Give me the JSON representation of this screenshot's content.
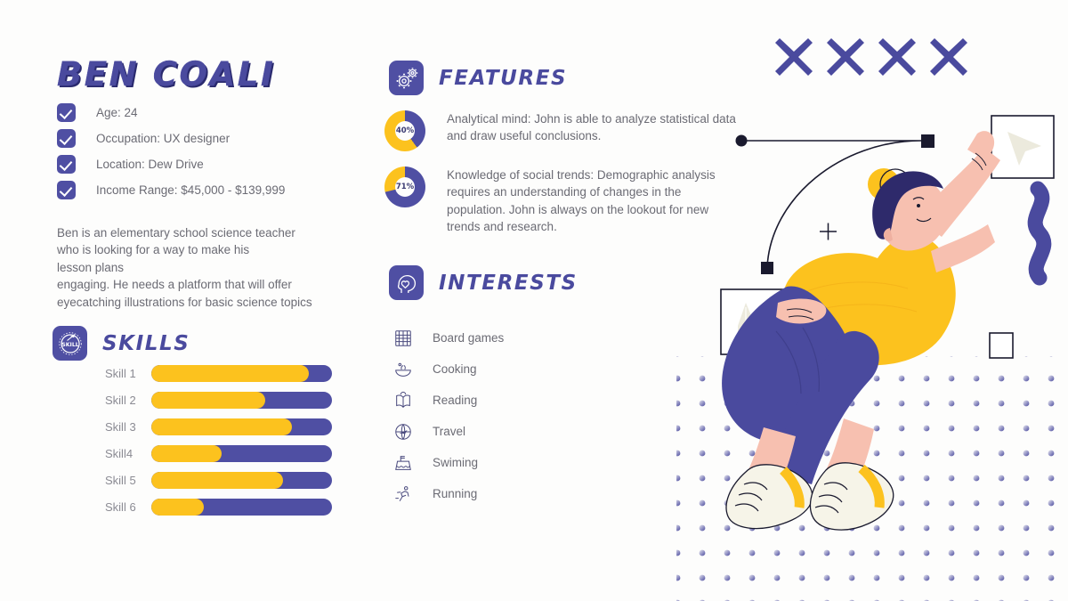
{
  "theme": {
    "background": "#fdfdfc",
    "blue": "#4a4a9e",
    "blue_solid": "#4f4fa3",
    "yellow": "#fcc21e",
    "text_gray": "#6b6b74",
    "dark": "#1a1a2e",
    "skin": "#f7c0b0"
  },
  "profile": {
    "name": "BEN COALI",
    "attributes": [
      {
        "label": "Age: 24",
        "icon": "check-icon"
      },
      {
        "label": "Occupation: UX designer",
        "icon": "check-icon"
      },
      {
        "label": "Location: Dew Drive",
        "icon": "check-icon"
      },
      {
        "label": "Income Range: $45,000 - $139,999",
        "icon": "check-icon"
      }
    ],
    "bio": "Ben is an elementary school science teacher\nwho is looking for a way to make his\nlesson plans\nengaging. He needs a platform that will offer\neyecatching illustrations for basic science topics"
  },
  "skills": {
    "title": "SKILLS",
    "icon": "skill-badge-icon",
    "items": [
      {
        "label": "Skill 1",
        "value": 87
      },
      {
        "label": "Skill 2",
        "value": 63
      },
      {
        "label": "Skill 3",
        "value": 78
      },
      {
        "label": "Skill4",
        "value": 39
      },
      {
        "label": "Skill 5",
        "value": 73
      },
      {
        "label": "Skill 6",
        "value": 29
      }
    ]
  },
  "features": {
    "title": "FEATURES",
    "icon": "gears-icon",
    "items": [
      {
        "percent": 40,
        "percent_label": "40%",
        "text": "Analytical mind: John is able to analyze statistical data and draw useful conclusions."
      },
      {
        "percent": 71,
        "percent_label": "71%",
        "text": "Knowledge of social trends: Demographic analysis requires an understanding of changes in the population. John is always on the lookout for new trends and research."
      }
    ]
  },
  "interests": {
    "title": "INTERESTS",
    "icon": "head-heart-icon",
    "items": [
      {
        "label": "Board games",
        "icon": "abacus-icon"
      },
      {
        "label": "Cooking",
        "icon": "bowl-icon"
      },
      {
        "label": "Reading",
        "icon": "open-book-icon"
      },
      {
        "label": "Travel",
        "icon": "globe-plane-icon"
      },
      {
        "label": "Swiming",
        "icon": "pool-icon"
      },
      {
        "label": "Running",
        "icon": "runner-icon"
      }
    ]
  },
  "decoration": {
    "x_marks_count": 4,
    "illustration": "man-sitting-floating-illustration"
  },
  "chart_data": [
    {
      "type": "bar",
      "title": "SKILLS",
      "orientation": "horizontal",
      "categories": [
        "Skill 1",
        "Skill 2",
        "Skill 3",
        "Skill4",
        "Skill 5",
        "Skill 6"
      ],
      "values": [
        87,
        63,
        78,
        39,
        73,
        29
      ],
      "xlabel": "",
      "ylabel": "",
      "xlim": [
        0,
        100
      ],
      "grid": false,
      "legend": "none",
      "fill_color": "#fcc21e",
      "track_color": "#4f4fa3"
    },
    {
      "type": "pie",
      "subtype": "donut",
      "title": "Analytical mind",
      "labels": [
        "filled",
        "remaining"
      ],
      "values": [
        40,
        60
      ],
      "data_label": "40%",
      "colors": [
        "#4f4fa3",
        "#fcc21e"
      ]
    },
    {
      "type": "pie",
      "subtype": "donut",
      "title": "Knowledge of social trends",
      "labels": [
        "filled",
        "remaining"
      ],
      "values": [
        71,
        29
      ],
      "data_label": "71%",
      "colors": [
        "#4f4fa3",
        "#fcc21e"
      ]
    }
  ]
}
